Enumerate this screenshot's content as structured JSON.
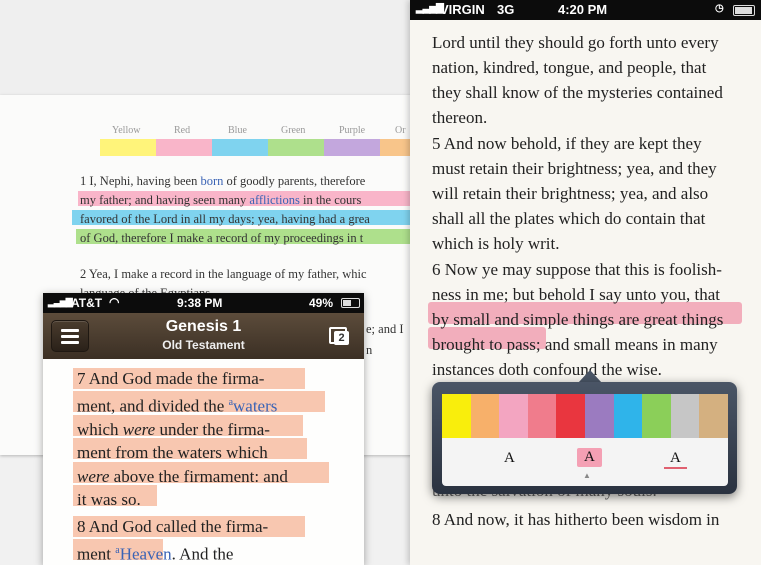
{
  "back_page": {
    "color_labels": [
      "Yellow",
      "Red",
      "Blue",
      "Green",
      "Purple",
      "Or"
    ],
    "colors": [
      "#fff47a",
      "#f9b5c9",
      "#7fd3ef",
      "#aee08c",
      "#c3a7dd",
      "#f8c58a"
    ],
    "verse1": {
      "line1_pre": "1 I, Nephi, having been ",
      "line1_link": "born",
      "line1_post": " of goodly parents, therefore",
      "line2_pre": "my father; and having seen many ",
      "line2_link": "afflictions",
      "line2_post": " in the cours",
      "line3": "favored of the Lord in all my days; yea, having had a grea",
      "line4": "of God, therefore I make a record of my proceedings in t"
    },
    "verse2": {
      "line1": "2 Yea, I make a record in the language of my father, whic",
      "line2": "language of the Egyptians",
      "frag_a": "e; and I",
      "frag_b": "n"
    }
  },
  "right_phone": {
    "status": {
      "carrier": "VIRGIN",
      "network": "3G",
      "time": "4:20 PM"
    },
    "lines": [
      "Lord until they should go forth unto every",
      "nation, kindred, tongue, and people, that",
      "they shall know of the mysteries contained",
      "thereon.",
      "5 And now behold, if they are kept they",
      "must retain their brightness; yea, and they",
      "will retain their brightness; yea, and also",
      "shall all the plates which do contain that",
      "which is holy writ.",
      "6 Now ye may suppose that this is foolish-",
      "ness in me; but behold I say unto you, that",
      "by small and simple things are great things",
      "brought to pass; and small means in many",
      "instances doth confound the wise."
    ],
    "hidden_line": "unto the salvation of many souls.",
    "bottom_line": "8 And now, it has hitherto been wisdom in",
    "palette": [
      "#f9ee0c",
      "#f7b06a",
      "#f3a5c1",
      "#f07c8c",
      "#e9363f",
      "#9b7bc0",
      "#2fb4ea",
      "#8bcf59",
      "#c6c6c6",
      "#d4b080"
    ],
    "style_letter": "A"
  },
  "left_phone": {
    "status": {
      "carrier": "AT&T",
      "time": "9:38 PM",
      "battery": "49%"
    },
    "title": "Genesis 1",
    "subtitle": "Old Testament",
    "tabs_count": "2",
    "v7": {
      "l1": "7 And God made the firma-",
      "l2_pre": "ment, and divided the ",
      "l2_sup": "a",
      "l2_link": "waters",
      "l3_pre": "which ",
      "l3_em": "were",
      "l3_post": " under the firma-",
      "l4": "ment from the waters which",
      "l5_em": "were",
      "l5_post": " above the firmament: and",
      "l6": "it was so."
    },
    "v8": {
      "l1": "8 And God called the firma-",
      "l2_pre": "ment ",
      "l2_sup": "a",
      "l2_link": "Heaven",
      "l2_post": ". And the"
    }
  }
}
